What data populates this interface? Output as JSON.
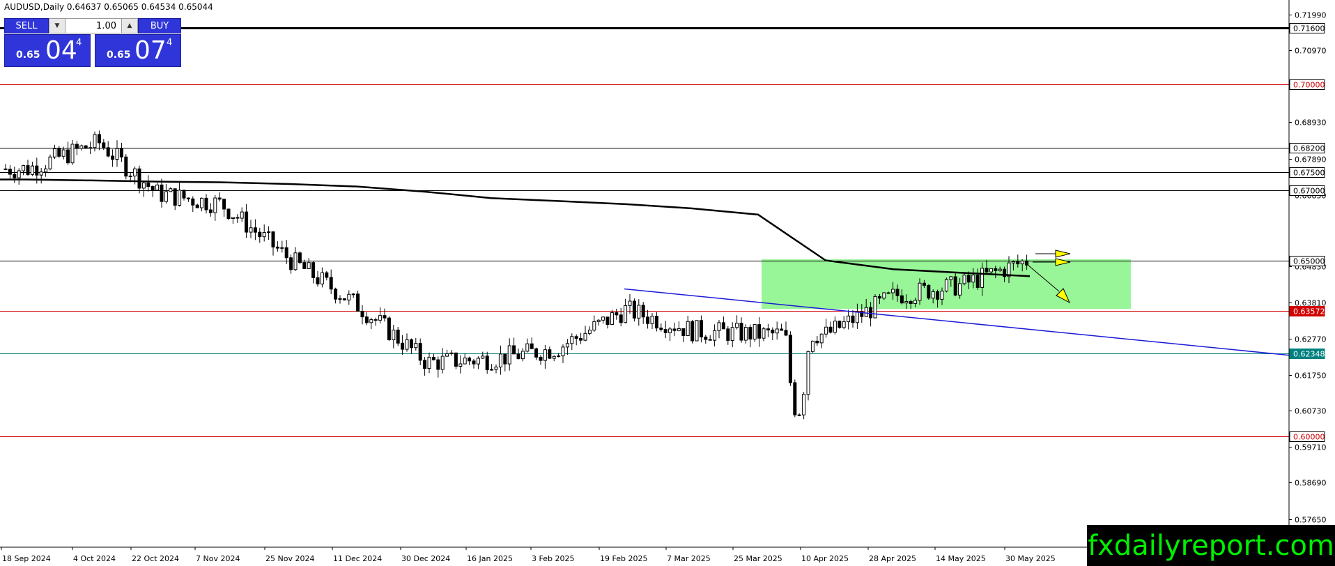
{
  "chart_title": "AUDUSD,Daily  0.64637 0.65065 0.64534 0.65044",
  "trade_panel": {
    "sell_label": "SELL",
    "buy_label": "BUY",
    "lot_value": "1.00",
    "sell_price_small": "0.65",
    "sell_price_big": "04",
    "sell_price_sup": "4",
    "buy_price_small": "0.65",
    "buy_price_big": "07",
    "buy_price_sup": "4"
  },
  "watermark": "fxdailyreport.com",
  "colors": {
    "panel_blue": "#2f35d8",
    "box_green": "#98f598",
    "trendline_blue": "#1a1ad8",
    "red_level": "#d00000",
    "teal_level": "#008080",
    "watermark_green": "#00f000"
  },
  "chart_data": {
    "type": "candlestick",
    "symbol": "AUDUSD",
    "timeframe": "Daily",
    "ylim": [
      0.5685,
      0.724
    ],
    "price_ticks": [
      "0.71990",
      "0.70970",
      "0.68930",
      "0.67890",
      "0.66850",
      "0.64830",
      "0.63810",
      "0.62770",
      "0.61750",
      "0.60730",
      "0.59710",
      "0.58690",
      "0.57650"
    ],
    "x_labels": [
      "18 Sep 2024",
      "4 Oct 2024",
      "22 Oct 2024",
      "7 Nov 2024",
      "25 Nov 2024",
      "11 Dec 2024",
      "30 Dec 2024",
      "16 Jan 2025",
      "3 Feb 2025",
      "19 Feb 2025",
      "7 Mar 2025",
      "25 Mar 2025",
      "10 Apr 2025",
      "28 Apr 2025",
      "14 May 2025",
      "30 May 2025"
    ],
    "horizontal_levels": [
      {
        "label": "0.71600",
        "value": 0.716,
        "color": "#000000",
        "style": "thick",
        "tag_bg": "#ffffff",
        "tag_fg": "#000000"
      },
      {
        "label": "0.70000",
        "value": 0.7,
        "color": "#d00000",
        "style": "thin",
        "tag_bg": "#ffffff",
        "tag_fg": "#d00000"
      },
      {
        "label": "0.68200",
        "value": 0.682,
        "color": "#000000",
        "style": "thin",
        "tag_bg": "#ffffff",
        "tag_fg": "#000000"
      },
      {
        "label": "0.67500",
        "value": 0.675,
        "color": "#000000",
        "style": "thin",
        "tag_bg": "#ffffff",
        "tag_fg": "#000000"
      },
      {
        "label": "0.67000",
        "value": 0.67,
        "color": "#000000",
        "style": "thin",
        "tag_bg": "#ffffff",
        "tag_fg": "#000000"
      },
      {
        "label": "0.65000",
        "value": 0.65,
        "color": "#000000",
        "style": "thin",
        "tag_bg": "#ffffff",
        "tag_fg": "#000000"
      },
      {
        "label": "0.63572",
        "value": 0.63572,
        "color": "#d00000",
        "style": "thin",
        "tag_bg": "#d00000",
        "tag_fg": "#ffffff"
      },
      {
        "label": "0.62348",
        "value": 0.62348,
        "color": "#008080",
        "style": "thin",
        "tag_bg": "#008080",
        "tag_fg": "#ffffff"
      },
      {
        "label": "0.60000",
        "value": 0.6,
        "color": "#d00000",
        "style": "thin",
        "tag_bg": "#ffffff",
        "tag_fg": "#d00000"
      }
    ],
    "moving_average": [
      {
        "date": "18 Sep 2024",
        "value": 0.673
      },
      {
        "date": "4 Oct 2024",
        "value": 0.6727
      },
      {
        "date": "22 Oct 2024",
        "value": 0.6724
      },
      {
        "date": "7 Nov 2024",
        "value": 0.6722
      },
      {
        "date": "25 Nov 2024",
        "value": 0.6717
      },
      {
        "date": "11 Dec 2024",
        "value": 0.671
      },
      {
        "date": "30 Dec 2024",
        "value": 0.6695
      },
      {
        "date": "16 Jan 2025",
        "value": 0.6677
      },
      {
        "date": "3 Feb 2025",
        "value": 0.6669
      },
      {
        "date": "19 Feb 2025",
        "value": 0.666
      },
      {
        "date": "7 Mar 2025",
        "value": 0.6648
      },
      {
        "date": "25 Mar 2025",
        "value": 0.663
      },
      {
        "date": "10 Apr 2025",
        "value": 0.65
      },
      {
        "date": "28 Apr 2025",
        "value": 0.6475
      },
      {
        "date": "14 May 2025",
        "value": 0.6465
      },
      {
        "date": "30 May 2025",
        "value": 0.6455
      }
    ],
    "trendline": {
      "start": {
        "date": "19 Feb 2025",
        "value": 0.6419
      },
      "end": {
        "date": "30 May 2025",
        "value": 0.6304
      }
    },
    "consolidation_box": {
      "start_date": "25 Mar 2025",
      "end_date": "30 May 2025",
      "top": 0.6503,
      "bottom": 0.6362
    },
    "closes": [
      {
        "date": "18 Sep 2024",
        "close": 0.676
      },
      {
        "date": "4 Oct 2024",
        "close": 0.6835
      },
      {
        "date": "22 Oct 2024",
        "close": 0.669
      },
      {
        "date": "7 Nov 2024",
        "close": 0.666
      },
      {
        "date": "25 Nov 2024",
        "close": 0.65
      },
      {
        "date": "11 Dec 2024",
        "close": 0.637
      },
      {
        "date": "30 Dec 2024",
        "close": 0.621
      },
      {
        "date": "16 Jan 2025",
        "close": 0.622
      },
      {
        "date": "3 Feb 2025",
        "close": 0.625
      },
      {
        "date": "19 Feb 2025",
        "close": 0.636
      },
      {
        "date": "7 Mar 2025",
        "close": 0.63
      },
      {
        "date": "25 Mar 2025",
        "close": 0.629
      },
      {
        "date": "10 Apr 2025",
        "close": 0.629
      },
      {
        "date": "28 Apr 2025",
        "close": 0.64
      },
      {
        "date": "14 May 2025",
        "close": 0.643
      },
      {
        "date": "30 May 2025",
        "close": 0.6504
      }
    ]
  }
}
